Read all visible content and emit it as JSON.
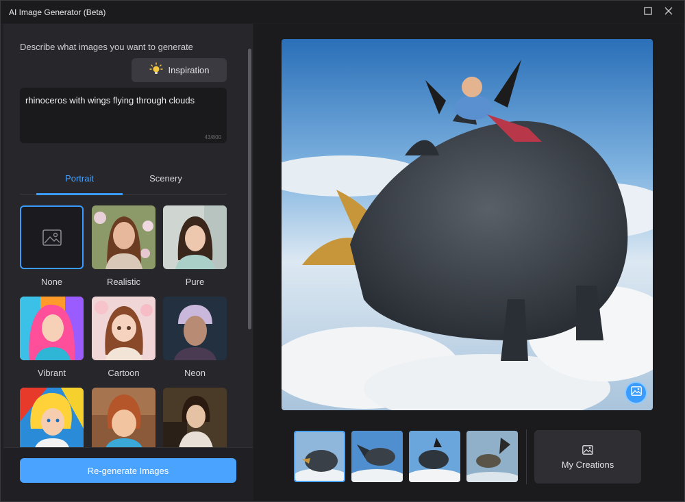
{
  "window": {
    "title": "AI Image Generator (Beta)"
  },
  "left": {
    "describe_label": "Describe what images you want to generate",
    "inspiration_label": "Inspiration",
    "prompt_text": "rhinoceros with wings flying through clouds",
    "counter": "43/800",
    "tabs": [
      {
        "label": "Portrait",
        "active": true
      },
      {
        "label": "Scenery",
        "active": false
      }
    ],
    "styles": [
      {
        "label": "None",
        "selected": true
      },
      {
        "label": "Realistic"
      },
      {
        "label": "Pure"
      },
      {
        "label": "Vibrant"
      },
      {
        "label": "Cartoon"
      },
      {
        "label": "Neon"
      },
      {
        "label": ""
      },
      {
        "label": ""
      },
      {
        "label": ""
      }
    ],
    "regenerate_label": "Re-generate Images"
  },
  "right": {
    "my_creations_label": "My Creations",
    "thumbnails_count": 4,
    "selected_thumbnail": 1
  },
  "colors": {
    "accent": "#3b9cff",
    "button": "#4aa3ff"
  }
}
